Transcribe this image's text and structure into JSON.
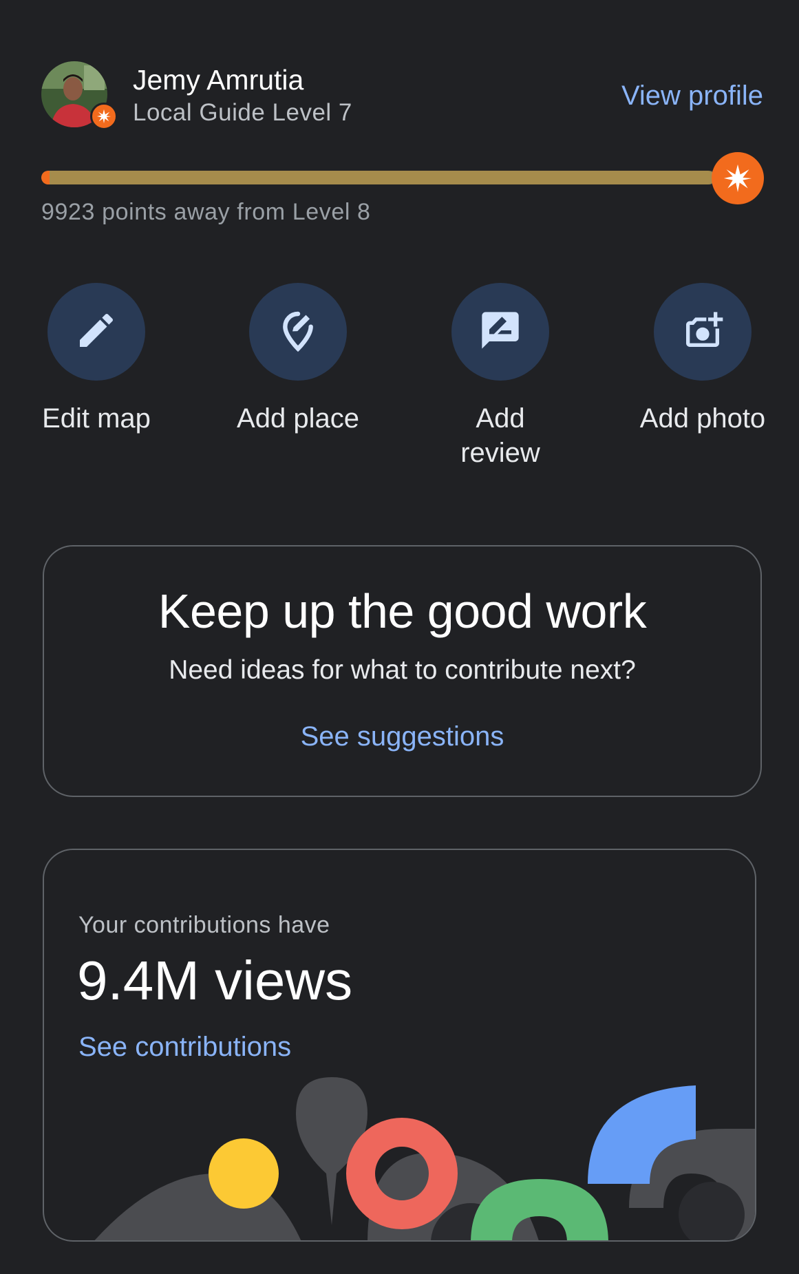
{
  "profile": {
    "name": "Jemy Amrutia",
    "level_text": "Local Guide Level 7",
    "view_profile_label": "View profile",
    "avatar_icon": "avatar-photo",
    "badge_icon": "local-guide-star-icon"
  },
  "progress": {
    "fraction": 0.97,
    "caption": "9923 points away from Level 8",
    "next_level_icon": "local-guide-star-icon"
  },
  "actions": [
    {
      "label": "Edit map",
      "icon": "pencil-icon"
    },
    {
      "label": "Add place",
      "icon": "add-place-pin-icon"
    },
    {
      "label": "Add review",
      "icon": "rate-review-icon"
    },
    {
      "label": "Add photo",
      "icon": "add-photo-camera-icon"
    }
  ],
  "suggestion_card": {
    "title": "Keep up the good work",
    "subtitle": "Need ideas for what to contribute next?",
    "link": "See suggestions"
  },
  "contributions_card": {
    "label": "Your contributions have",
    "views": "9.4M views",
    "link": "See contributions"
  },
  "colors": {
    "background": "#202124",
    "accent_link": "#8ab4f8",
    "progress_fill": "#a68c4c",
    "level_orange": "#f26b1d",
    "action_circle": "#293a55",
    "card_border": "#5f6368"
  }
}
